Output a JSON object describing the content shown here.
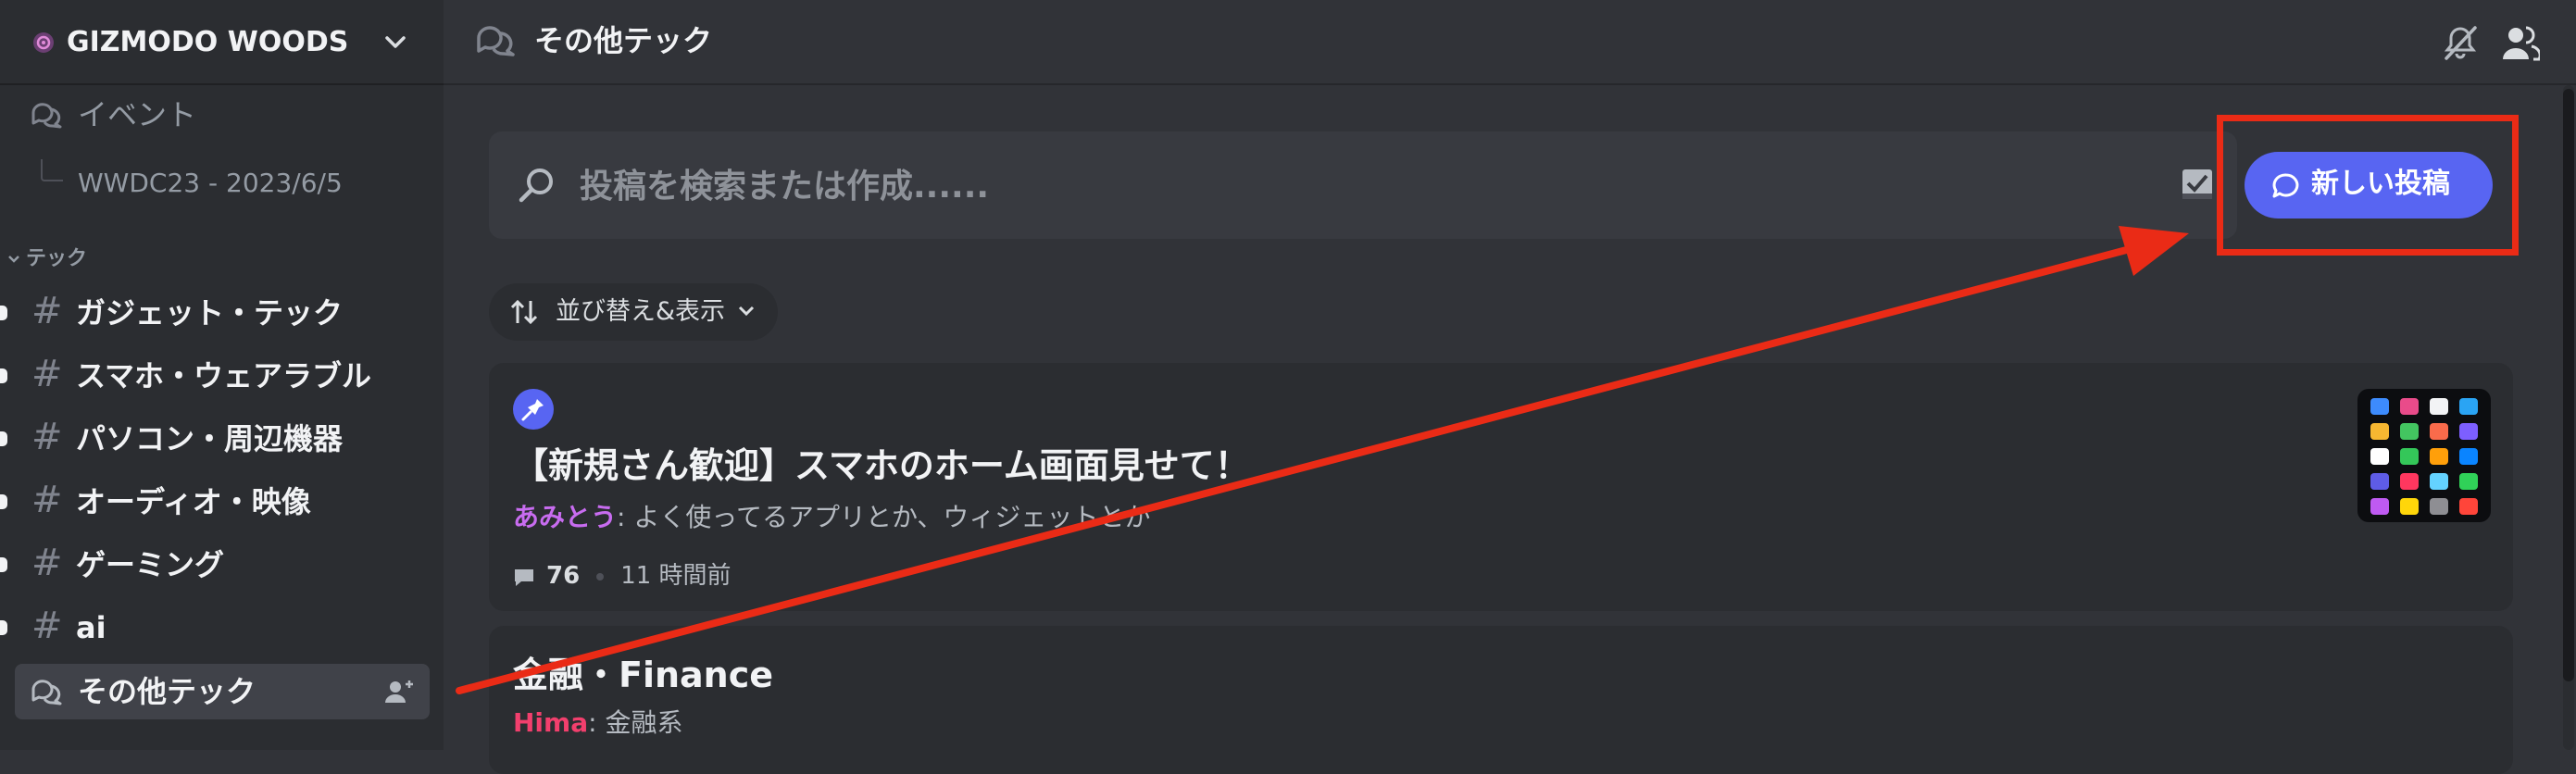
{
  "server": {
    "name": "GIZMODO WOODS"
  },
  "sidebar": {
    "forum_events": {
      "label": "イベント"
    },
    "thread": {
      "label": "WWDC23 - 2023/6/5"
    },
    "category": {
      "label": "テック"
    },
    "text_channels": [
      {
        "label": "ガジェット・テック"
      },
      {
        "label": "スマホ・ウェアラブル"
      },
      {
        "label": "パソコン・周辺機器"
      },
      {
        "label": "オーディオ・映像"
      },
      {
        "label": "ゲーミング"
      },
      {
        "label": "ai"
      }
    ],
    "active_channel": {
      "label": "その他テック"
    }
  },
  "topbar": {
    "title": "その他テック"
  },
  "search": {
    "placeholder": "投稿を検索または作成......"
  },
  "new_post": {
    "label": "新しい投稿"
  },
  "sort": {
    "label": "並び替え&表示"
  },
  "posts": [
    {
      "pinned": true,
      "title": "【新規さん歓迎】スマホのホーム画面見せて！",
      "author": "あみとう",
      "author_color": "#c86cf0",
      "preview": ": よく使ってるアプリとか、ウィジェットとか",
      "replies": "76",
      "time": "11 時間前"
    },
    {
      "pinned": false,
      "title": "金融・Finance",
      "author": "Hima",
      "author_color": "#f23f6d",
      "preview": ": 金融系"
    }
  ],
  "colors": {
    "accent": "#5865f2",
    "annotation_red": "#ea2b16",
    "background": "#313338",
    "sidebar": "#2b2d31"
  }
}
